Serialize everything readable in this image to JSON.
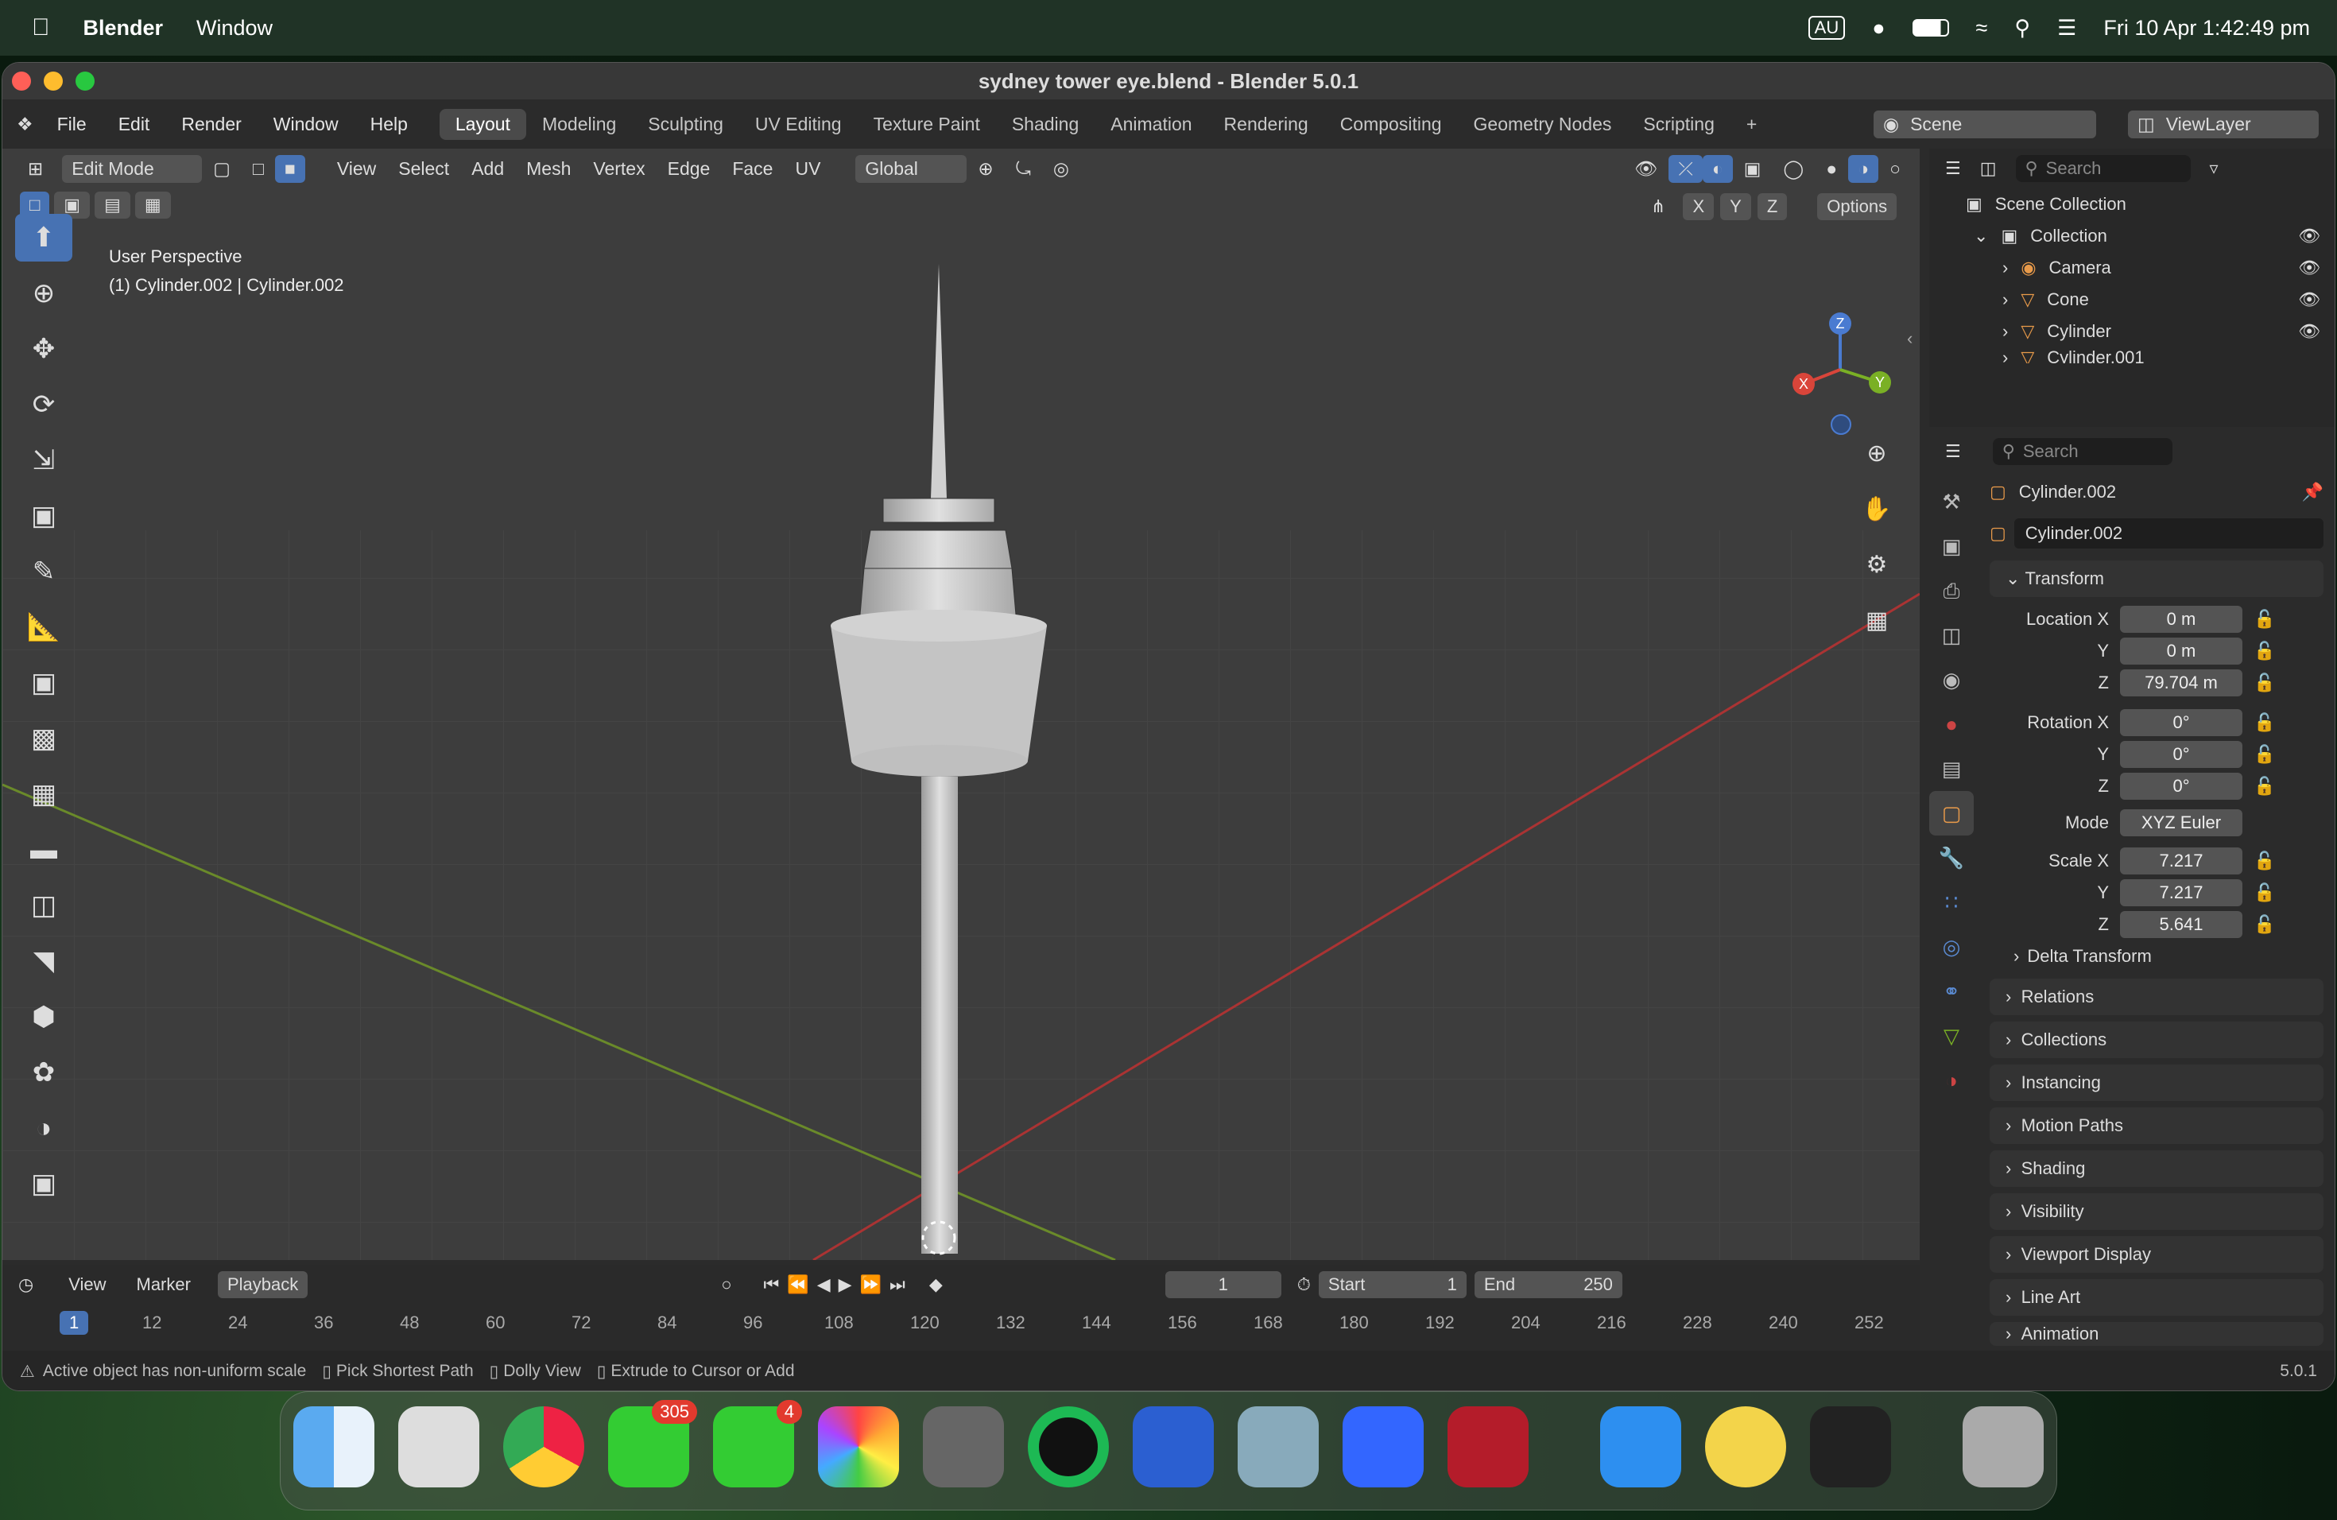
{
  "menubar": {
    "app_name": "Blender",
    "menu_window": "Window",
    "region_badge": "AU",
    "datetime": "Fri 10 Apr  1:42:49 pm"
  },
  "window": {
    "title": "sydney tower eye.blend - Blender 5.0.1"
  },
  "topbar": {
    "menus": [
      "File",
      "Edit",
      "Render",
      "Window",
      "Help"
    ],
    "workspaces": [
      "Layout",
      "Modeling",
      "Sculpting",
      "UV Editing",
      "Texture Paint",
      "Shading",
      "Animation",
      "Rendering",
      "Compositing",
      "Geometry Nodes",
      "Scripting"
    ],
    "active_workspace": "Layout",
    "add_tab": "+",
    "scene": "Scene",
    "view_layer": "ViewLayer"
  },
  "viewport": {
    "mode": "Edit Mode",
    "menus": [
      "View",
      "Select",
      "Add",
      "Mesh",
      "Vertex",
      "Edge",
      "Face",
      "UV"
    ],
    "transform_orientation": "Global",
    "axis_x": "X",
    "axis_y": "Y",
    "axis_z": "Z",
    "options": "Options",
    "overlay_line1": "User Perspective",
    "overlay_line2": "(1) Cylinder.002 | Cylinder.002",
    "gizmo_z": "Z",
    "gizmo_x": "X",
    "gizmo_y": "Y"
  },
  "outliner": {
    "search_placeholder": "Search",
    "scene_collection": "Scene Collection",
    "collection": "Collection",
    "items": [
      "Camera",
      "Cone",
      "Cylinder",
      "Cylinder.001"
    ]
  },
  "properties": {
    "search_placeholder": "Search",
    "object_name": "Cylinder.002",
    "object_field": "Cylinder.002",
    "transform_label": "Transform",
    "location_x_label": "Location X",
    "location_x": "0 m",
    "location_y_label": "Y",
    "location_y": "0 m",
    "location_z_label": "Z",
    "location_z": "79.704 m",
    "rotation_x_label": "Rotation X",
    "rotation_x": "0°",
    "rotation_y_label": "Y",
    "rotation_y": "0°",
    "rotation_z_label": "Z",
    "rotation_z": "0°",
    "mode_label": "Mode",
    "mode_value": "XYZ Euler",
    "scale_x_label": "Scale X",
    "scale_x": "7.217",
    "scale_y_label": "Y",
    "scale_y": "7.217",
    "scale_z_label": "Z",
    "scale_z": "5.641",
    "delta_transform": "Delta Transform",
    "panels": [
      "Relations",
      "Collections",
      "Instancing",
      "Motion Paths",
      "Shading",
      "Visibility",
      "Viewport Display",
      "Line Art",
      "Animation"
    ]
  },
  "timeline": {
    "menus": [
      "View",
      "Marker",
      "Playback"
    ],
    "current_frame": "1",
    "start_label": "Start",
    "start": "1",
    "end_label": "End",
    "end": "250",
    "ruler": [
      "1",
      "12",
      "24",
      "36",
      "48",
      "60",
      "72",
      "84",
      "96",
      "108",
      "120",
      "132",
      "144",
      "156",
      "168",
      "180",
      "192",
      "204",
      "216",
      "228",
      "240",
      "252"
    ]
  },
  "statusbar": {
    "warning": "Active object has non-uniform scale",
    "hint1": "Pick Shortest Path",
    "hint2": "Dolly View",
    "hint3": "Extrude to Cursor or Add",
    "version": "5.0.1"
  },
  "dock": {
    "messages_badge": "305",
    "facetime_badge": "4"
  }
}
